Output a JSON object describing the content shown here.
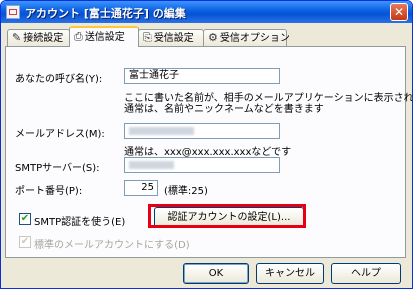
{
  "window": {
    "title": "アカウント [富士通花子] の編集",
    "close_glyph": "✕"
  },
  "tabs": [
    {
      "label": "接続設定",
      "icon": "wrench-icon"
    },
    {
      "label": "送信設定",
      "icon": "send-icon"
    },
    {
      "label": "受信設定",
      "icon": "receive-icon"
    },
    {
      "label": "受信オプション",
      "icon": "option-icon"
    }
  ],
  "active_tab": "送信設定",
  "form": {
    "name_label": "あなたの呼び名(Y):",
    "name_value": "富士通花子",
    "name_help_1": "ここに書いた名前が、相手のメールアプリケーションに表示されます",
    "name_help_2": "通常は、名前やニックネームなどを書きます",
    "email_label": "メールアドレス(M):",
    "email_help_prefix": "通常は、",
    "email_help_example": "xxx@xxx.xxx.xxx",
    "email_help_suffix": "などです",
    "smtp_label": "SMTPサーバー(S):",
    "port_label": "ポート番号(P):",
    "port_value": "25",
    "port_default": "(標準:25)",
    "smtp_auth_label": "SMTP認証を使う(E)",
    "smtp_auth_checked": true,
    "auth_settings_button": "認証アカウントの設定(L)...",
    "default_account_label": "標準のメールアカウントにする(D)",
    "default_account_checked": true,
    "default_account_disabled": true
  },
  "buttons": {
    "ok": "OK",
    "cancel": "キャンセル",
    "help": "ヘルプ"
  },
  "colors": {
    "highlight": "#e60012",
    "titlebar": "#0a5fe0"
  }
}
